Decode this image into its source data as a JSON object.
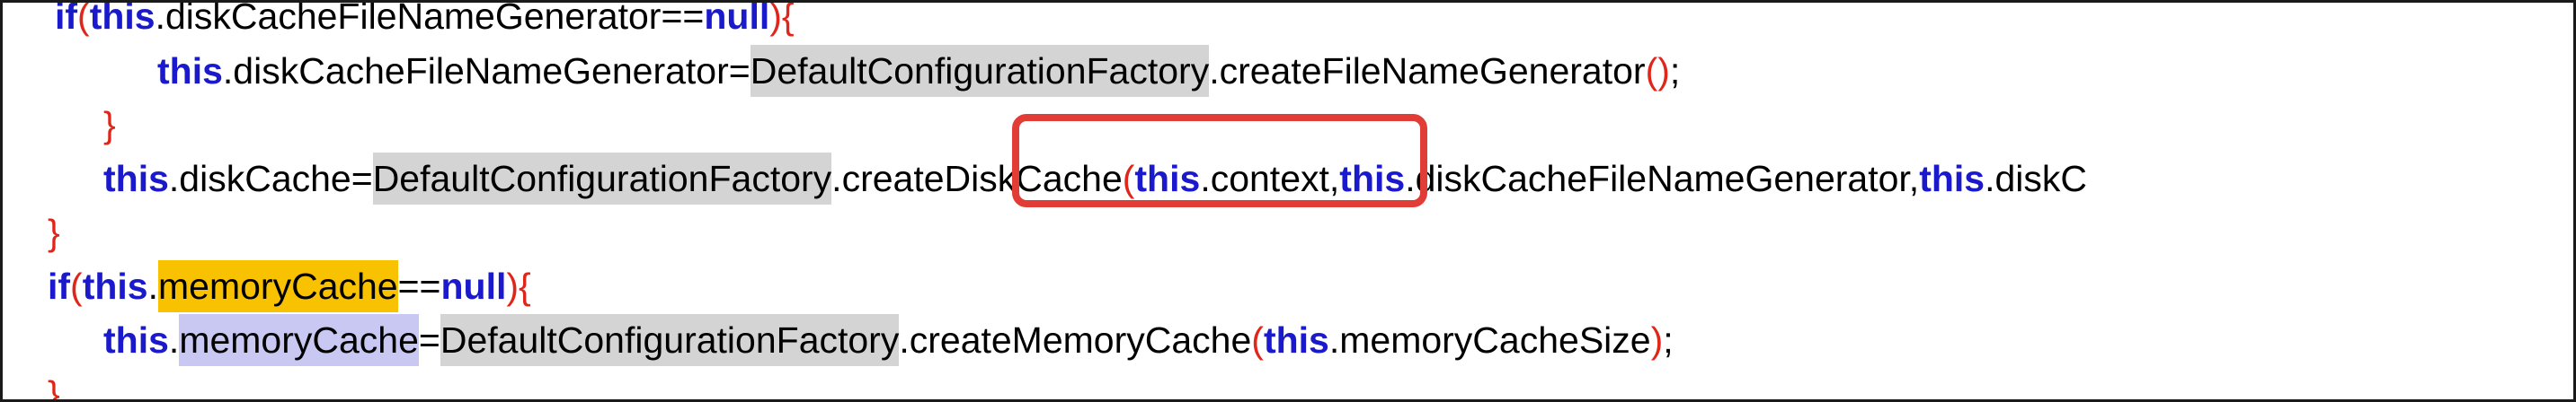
{
  "lines": [
    {
      "t1": "if",
      "t2": " (",
      "t3": "this",
      "t4": ".diskCacheFileNameGenerator",
      "t5": " == ",
      "t6": "null",
      "t7": ")",
      "t8": " {"
    },
    {
      "t1": "this",
      "t2": ".diskCacheFileNameGenerator",
      "t3": " = ",
      "t4": "DefaultConfigurationFactory",
      "t5": ".createFileNameGenerator",
      "t6": "()",
      "t7": ";"
    },
    {
      "t1": "}"
    },
    {
      "t1": "this",
      "t2": ".diskCache",
      "t3": " = ",
      "t4": "DefaultConfigurationFactory",
      "t5": ".createDiskCache",
      "t6": "(",
      "t7": "this",
      "t8": ".context, ",
      "t9": "this",
      "t10": ".diskCacheFileNameGenerator, ",
      "t11": "this",
      "t12": ".diskC"
    },
    {
      "t1": "}"
    },
    {
      "t1": "if",
      "t2": " (",
      "t3": "this",
      "t4": ".",
      "t5": "memoryCache",
      "t6": " == ",
      "t7": "null",
      "t8": ")",
      "t9": " {"
    },
    {
      "t1": "this",
      "t2": ".",
      "t3": "memoryCache",
      "t4": " = ",
      "t5": "DefaultConfigurationFactory",
      "t6": ".createMemoryCache",
      "t7": "(",
      "t8": "this",
      "t9": ".memoryCacheSize",
      "t10": ")",
      "t11": ";"
    },
    {
      "t1": "}"
    }
  ],
  "colors": {
    "keyword": "#1a1acc",
    "bracket": "#e0261b",
    "class_highlight": "#d4d4d4",
    "occurrence_highlight": "#f8c200",
    "field_highlight": "#c9c8f3",
    "annotation_box": "#e23c36"
  }
}
